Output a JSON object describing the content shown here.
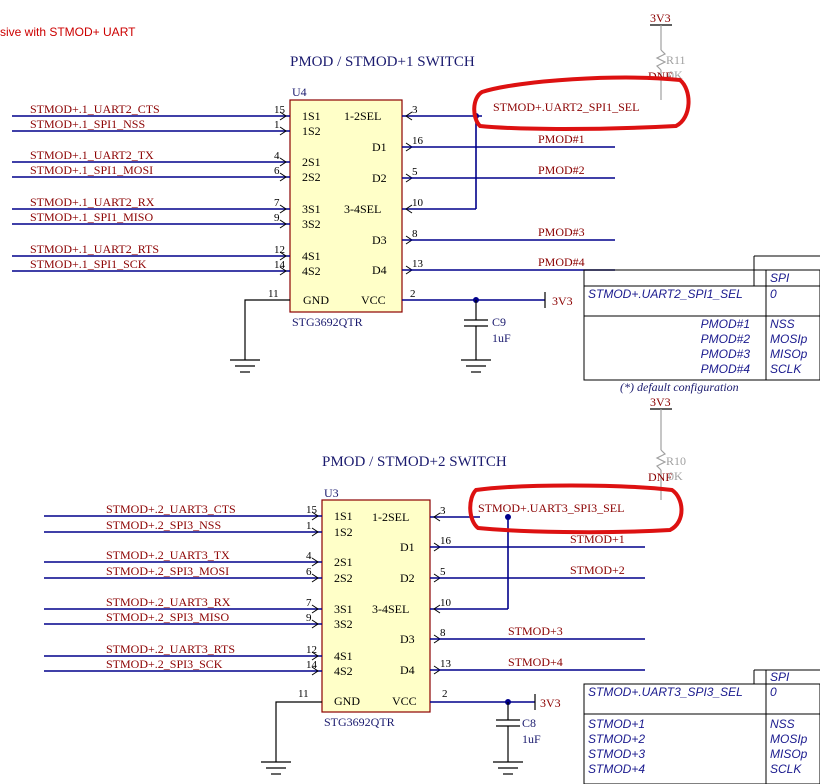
{
  "header_note": "sive with STMOD+ UART",
  "switch1": {
    "title": "PMOD / STMOD+1 SWITCH",
    "ref": "U4",
    "part": "STG3692QTR",
    "inputs": [
      {
        "net": "STMOD+.1_UART2_CTS",
        "pin": "15"
      },
      {
        "net": "STMOD+.1_SPI1_NSS",
        "pin": "1"
      },
      {
        "net": "STMOD+.1_UART2_TX",
        "pin": "4"
      },
      {
        "net": "STMOD+.1_SPI1_MOSI",
        "pin": "6"
      },
      {
        "net": "STMOD+.1_UART2_RX",
        "pin": "7"
      },
      {
        "net": "STMOD+.1_SPI1_MISO",
        "pin": "9"
      },
      {
        "net": "STMOD+.1_UART2_RTS",
        "pin": "12"
      },
      {
        "net": "STMOD+.1_SPI1_SCK",
        "pin": "14"
      }
    ],
    "left_pins": [
      "1S1",
      "1S2",
      "2S1",
      "2S2",
      "3S1",
      "3S2",
      "4S1",
      "4S2"
    ],
    "gnd_label": "GND",
    "gnd_pin": "11",
    "vcc_label": "VCC",
    "vcc_pin": "2",
    "sel12": "1-2SEL",
    "sel12_pin": "3",
    "sel34": "3-4SEL",
    "sel34_pin": "10",
    "outputs": [
      {
        "pinname": "D1",
        "pin": "16",
        "net": "PMOD#1"
      },
      {
        "pinname": "D2",
        "pin": "5",
        "net": "PMOD#2"
      },
      {
        "pinname": "D3",
        "pin": "8",
        "net": "PMOD#3"
      },
      {
        "pinname": "D4",
        "pin": "13",
        "net": "PMOD#4"
      }
    ],
    "sel_net": "STMOD+.UART2_SPI1_SEL",
    "cap_ref": "C9",
    "cap_val": "1uF",
    "vcc_net": "3V3",
    "res_ref": "R11",
    "res_val": "0K",
    "res_dnf": "DNF",
    "res_pwr": "3V3"
  },
  "table1": {
    "header": "SPI",
    "sel_row": "STMOD+.UART2_SPI1_SEL",
    "sel_val": "0",
    "rows": [
      {
        "net": "PMOD#1",
        "fn": "NSS"
      },
      {
        "net": "PMOD#2",
        "fn": "MOSIp"
      },
      {
        "net": "PMOD#3",
        "fn": "MISOp"
      },
      {
        "net": "PMOD#4",
        "fn": "SCLK"
      }
    ],
    "note": "(*) default configuration"
  },
  "switch2": {
    "title": "PMOD / STMOD+2 SWITCH",
    "ref": "U3",
    "part": "STG3692QTR",
    "inputs": [
      {
        "net": "STMOD+.2_UART3_CTS",
        "pin": "15"
      },
      {
        "net": "STMOD+.2_SPI3_NSS",
        "pin": "1"
      },
      {
        "net": "STMOD+.2_UART3_TX",
        "pin": "4"
      },
      {
        "net": "STMOD+.2_SPI3_MOSI",
        "pin": "6"
      },
      {
        "net": "STMOD+.2_UART3_RX",
        "pin": "7"
      },
      {
        "net": "STMOD+.2_SPI3_MISO",
        "pin": "9"
      },
      {
        "net": "STMOD+.2_UART3_RTS",
        "pin": "12"
      },
      {
        "net": "STMOD+.2_SPI3_SCK",
        "pin": "14"
      }
    ],
    "left_pins": [
      "1S1",
      "1S2",
      "2S1",
      "2S2",
      "3S1",
      "3S2",
      "4S1",
      "4S2"
    ],
    "gnd_label": "GND",
    "gnd_pin": "11",
    "vcc_label": "VCC",
    "vcc_pin": "2",
    "sel12": "1-2SEL",
    "sel12_pin": "3",
    "sel34": "3-4SEL",
    "sel34_pin": "10",
    "outputs": [
      {
        "pinname": "D1",
        "pin": "16",
        "net": "STMOD+1"
      },
      {
        "pinname": "D2",
        "pin": "5",
        "net": "STMOD+2"
      },
      {
        "pinname": "D3",
        "pin": "8",
        "net": "STMOD+3"
      },
      {
        "pinname": "D4",
        "pin": "13",
        "net": "STMOD+4"
      }
    ],
    "sel_net": "STMOD+.UART3_SPI3_SEL",
    "cap_ref": "C8",
    "cap_val": "1uF",
    "vcc_net": "3V3",
    "res_ref": "R10",
    "res_val": "0K",
    "res_dnf": "DNF",
    "res_pwr": "3V3"
  },
  "table2": {
    "header": "SPI",
    "sel_row": "STMOD+.UART3_SPI3_SEL",
    "sel_val": "0",
    "rows": [
      {
        "net": "STMOD+1",
        "fn": "NSS"
      },
      {
        "net": "STMOD+2",
        "fn": "MOSIp"
      },
      {
        "net": "STMOD+3",
        "fn": "MISOp"
      },
      {
        "net": "STMOD+4",
        "fn": "SCLK"
      }
    ]
  },
  "colors": {
    "wire": "#00008b",
    "label": "#8b0000",
    "chip": "#ffffc8",
    "highlight": "#dd1111"
  }
}
